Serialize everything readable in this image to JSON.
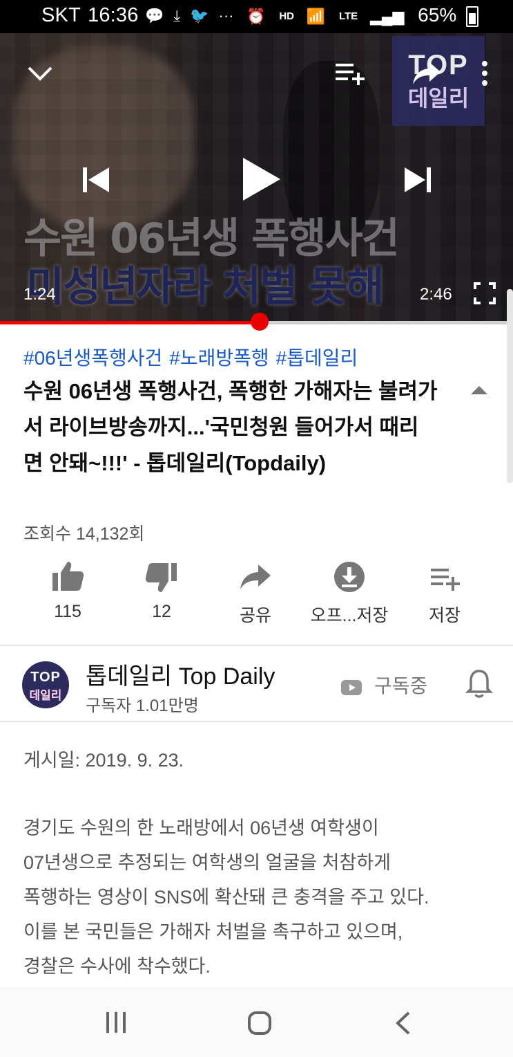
{
  "status_bar": {
    "carrier": "SKT",
    "time": "16:36",
    "notification_icons": [
      "talk-icon",
      "download-icon",
      "twitter-icon",
      "more-notifications-icon"
    ],
    "hd_voice": "HD",
    "network": "LTE",
    "battery": "65%"
  },
  "player": {
    "overlay_title_line1": "수원 06년생 폭행사건",
    "overlay_title_line2": "미성년자라 처벌 못해",
    "logo_line1": "TOP",
    "logo_line2": "데일리",
    "current_time": "1:24",
    "duration": "2:46",
    "progress_fraction": 0.506
  },
  "video": {
    "hashtags": [
      "#06년생폭행사건",
      "#노래방폭행",
      "#톱데일리"
    ],
    "title": "수원 06년생 폭행사건, 폭행한 가해자는 불려가서 라이브방송까지...'국민청원 들어가서 때리면 안돼~!!!' - 톱데일리(Topdaily)",
    "views": "조회수 14,132회"
  },
  "actions": {
    "like": "115",
    "dislike": "12",
    "share": "공유",
    "offline": "오프...저장",
    "save": "저장"
  },
  "channel": {
    "avatar_line1": "TOP",
    "avatar_line2": "데일리",
    "name": "톱데일리 Top Daily",
    "subscribers": "구독자 1.01만명",
    "subscribe_state": "구독중"
  },
  "description": {
    "date": "게시일: 2019. 9. 23.",
    "lines": [
      "경기도 수원의 한 노래방에서 06년생 여학생이",
      "07년생으로 추정되는 여학생의 얼굴을 처참하게",
      "폭행하는 영상이 SNS에 확산돼 큰 충격을 주고 있다.",
      "이를 본 국민들은 가해자 처벌을 촉구하고 있으며,",
      "경찰은 수사에 착수했다."
    ]
  },
  "colors": {
    "accent_red": "#ee0000",
    "hashtag_blue": "#1659c7",
    "channel_brand": "#2d2a5e"
  }
}
